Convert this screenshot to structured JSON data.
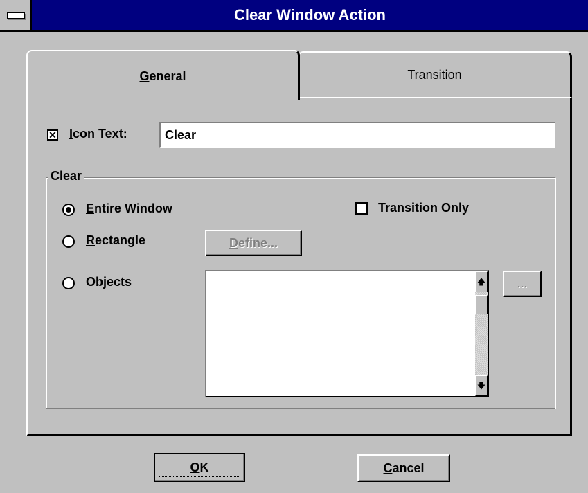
{
  "window": {
    "title": "Clear Window Action"
  },
  "tabs": [
    {
      "label": "General",
      "mnemonic_index": 0,
      "active": true
    },
    {
      "label": "Transition",
      "mnemonic_index": 0,
      "active": false
    }
  ],
  "icon_text": {
    "checked": true,
    "check_mark": "✕",
    "label": "Icon Text:",
    "value": "Clear"
  },
  "clear_group": {
    "title": "Clear",
    "options": [
      {
        "label": "Entire Window",
        "selected": true
      },
      {
        "label": "Rectangle",
        "selected": false
      },
      {
        "label": "Objects",
        "selected": false
      }
    ],
    "transition_only": {
      "label": "Transition Only",
      "checked": false
    },
    "define_button": "Define...",
    "browse_button": "...",
    "objects_list": []
  },
  "scroll": {
    "up_icon": "arrow-up-icon",
    "down_icon": "arrow-down-icon",
    "up_glyph": "🡅",
    "down_glyph": "🡇"
  },
  "footer": {
    "ok_label": "OK",
    "cancel_label": "Cancel"
  },
  "colors": {
    "title_bar": "#000080",
    "face": "#c0c0c0",
    "field": "#ffffff"
  }
}
